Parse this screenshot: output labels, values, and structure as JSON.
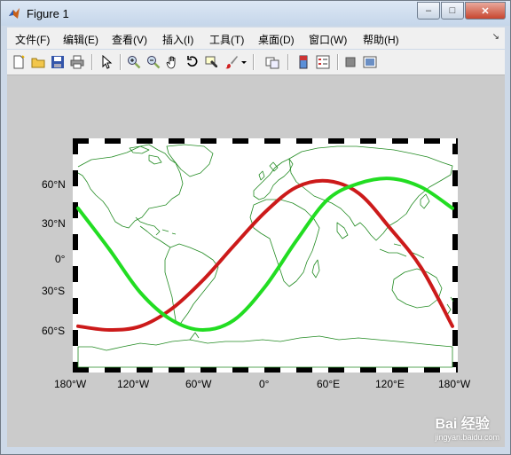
{
  "window": {
    "title": "Figure 1"
  },
  "menu": {
    "items": [
      {
        "label": "文件(F)"
      },
      {
        "label": "编辑(E)"
      },
      {
        "label": "查看(V)"
      },
      {
        "label": "插入(I)"
      },
      {
        "label": "工具(T)"
      },
      {
        "label": "桌面(D)"
      },
      {
        "label": "窗口(W)"
      },
      {
        "label": "帮助(H)"
      }
    ]
  },
  "toolbar": {
    "buttons": [
      "new-figure-icon",
      "open-file-icon",
      "save-icon",
      "print-icon",
      "pointer-icon",
      "zoom-in-icon",
      "zoom-out-icon",
      "pan-hand-icon",
      "rotate-3d-icon",
      "data-cursor-icon",
      "brush-icon",
      "link-plot-icon",
      "colorbar-icon",
      "legend-icon",
      "hide-plot-tools-icon",
      "show-plot-tools-icon"
    ]
  },
  "axes": {
    "lat_labels": [
      "60°N",
      "30°N",
      "0°",
      "30°S",
      "60°S"
    ],
    "lon_labels": [
      "180°W",
      "120°W",
      "60°W",
      "0°",
      "60°E",
      "120°E",
      "180°W"
    ]
  },
  "watermark": {
    "brand": "Bai 经验",
    "url": "jingyan.baidu.com"
  },
  "colors": {
    "track_red": "#cc1a1a",
    "track_green": "#22dd22",
    "coast": "#228b22"
  },
  "chart_data": {
    "type": "line",
    "xlim": [
      -180,
      180
    ],
    "ylim": [
      -90,
      90
    ],
    "series": [
      {
        "x": [
          -180,
          -150,
          -120,
          -90,
          -60,
          -30,
          0,
          30,
          60,
          90,
          120,
          150,
          180
        ],
        "y": [
          -57,
          -60,
          -57,
          -43,
          -20,
          8,
          35,
          55,
          60,
          50,
          22,
          -10,
          -57
        ]
      },
      {
        "x": [
          -180,
          -150,
          -120,
          -90,
          -60,
          -30,
          0,
          30,
          60,
          90,
          120,
          150,
          180
        ],
        "y": [
          38,
          5,
          -30,
          -52,
          -60,
          -52,
          -25,
          12,
          45,
          58,
          62,
          55,
          38
        ]
      }
    ]
  }
}
